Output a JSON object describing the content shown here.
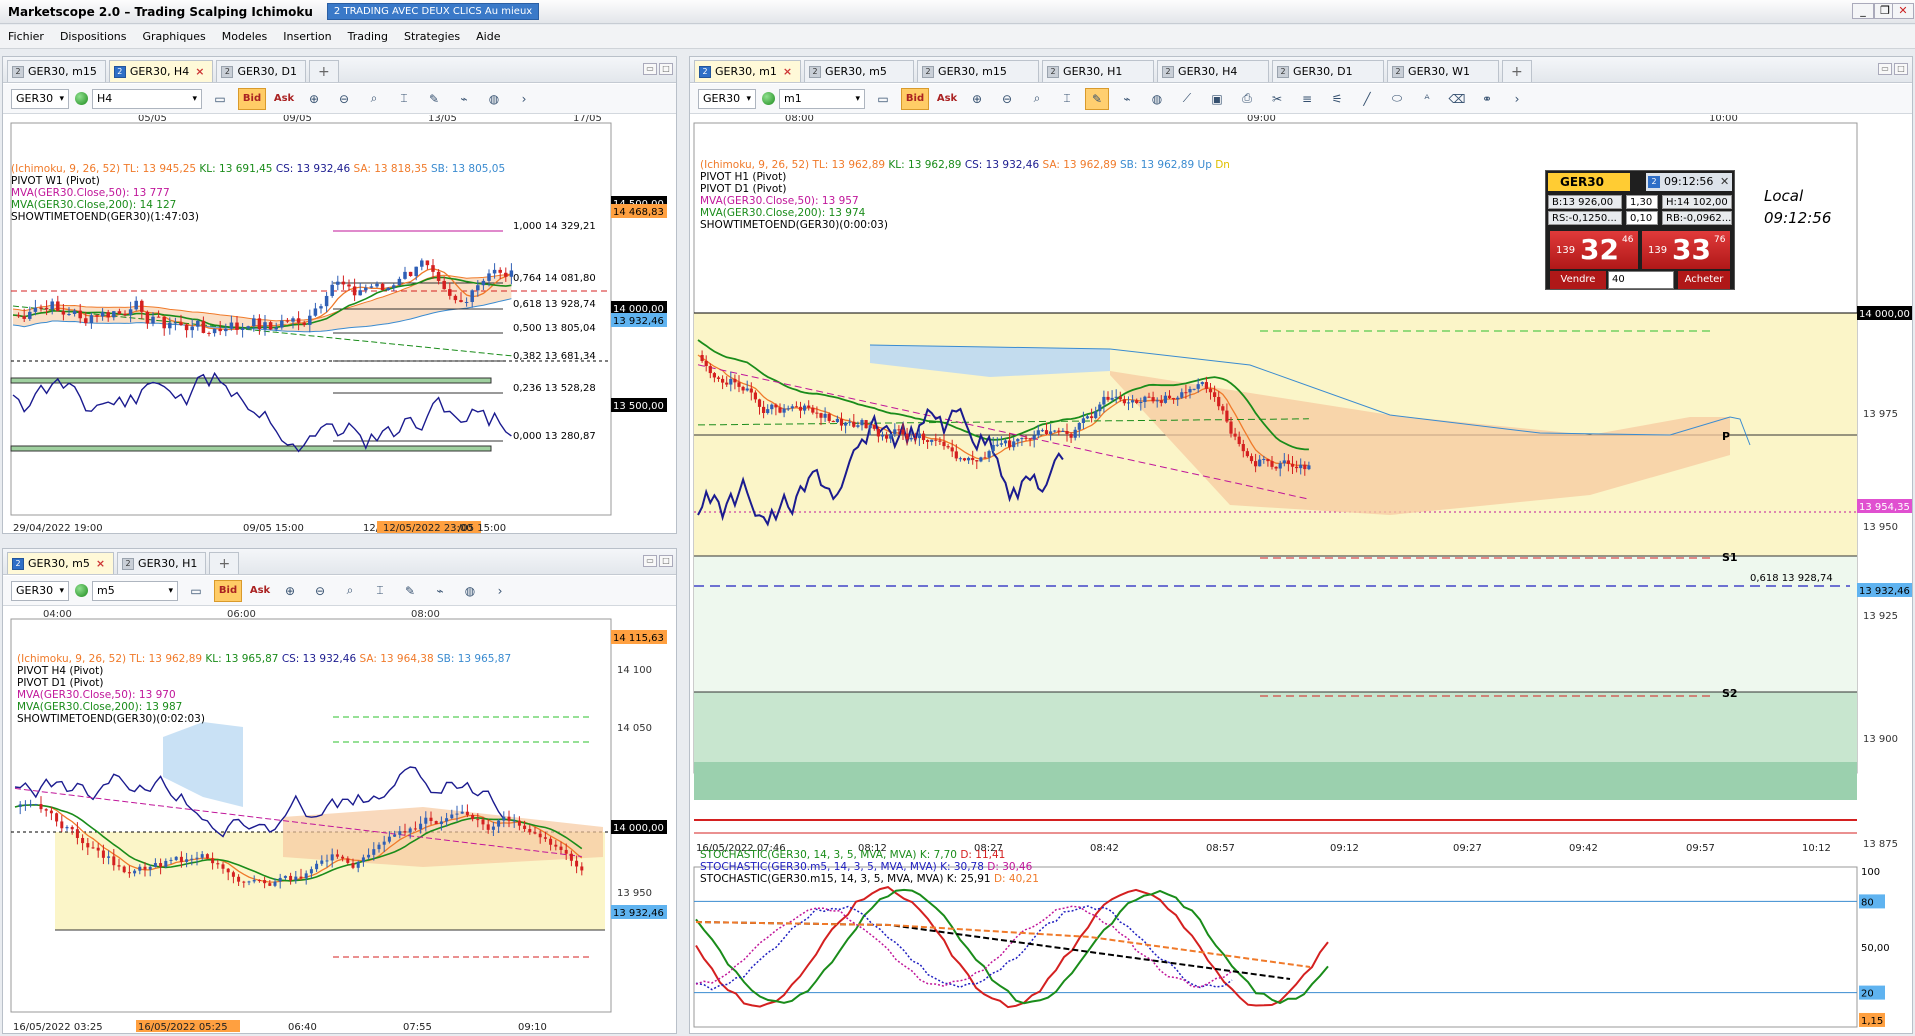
{
  "app": {
    "title": "Marketscope 2.0 – Trading Scalping Ichimoku",
    "badge": "TRADING AVEC DEUX CLICS Au mieux",
    "badge_num": "2",
    "win_min": "_",
    "win_max": "❐",
    "win_close": "✕"
  },
  "menu": [
    "Fichier",
    "Dispositions",
    "Graphiques",
    "Modeles",
    "Insertion",
    "Trading",
    "Strategies",
    "Aide"
  ],
  "panel_tl": {
    "tabs": [
      {
        "label": "GER30, m15",
        "icon": "2"
      },
      {
        "label": "GER30, H4",
        "icon": "2",
        "active": true
      },
      {
        "label": "GER30, D1",
        "icon": "2"
      }
    ],
    "symbol": "GER30",
    "timeframe": "H4",
    "bid": "Bid",
    "ask": "Ask",
    "dates": [
      "05/05",
      "09/05",
      "13/05",
      "17/05"
    ],
    "legend": {
      "ichimoku": "(Ichimoku, 9, 26, 52)",
      "tl": "TL: 13 945,25",
      "kl": "KL: 13 691,45",
      "cs": "CS: 13 932,46",
      "sa": "SA: 13 818,35",
      "sb": "SB: 13 805,05",
      "pivot": "PIVOT W1 (Pivot)",
      "mva50": "MVA(GER30.Close,50): 13 777",
      "mva200": "MVA(GER30.Close,200): 14 127",
      "showtime": "SHOWTIMETOEND(GER30)(1:47:03)"
    },
    "fibs": [
      "1,000 14 329,21",
      "0,764 14 081,80",
      "0,618 13 928,74",
      "0,500 13 805,04",
      "0,382 13 681,34",
      "0,236 13 528,28",
      "0,000 13 280,87"
    ],
    "price_tags": [
      "14 500,00",
      "14 468,83",
      "14 000,00",
      "13 932,46",
      "13 500,00"
    ],
    "bottom_axis": [
      "29/04/2022 19:00",
      "09/05 15:00",
      "12/",
      "12/05/2022 23:00",
      "/05 15:00"
    ]
  },
  "panel_bl": {
    "tabs": [
      {
        "label": "GER30, m5",
        "icon": "2",
        "active": true
      },
      {
        "label": "GER30, H1",
        "icon": "2"
      }
    ],
    "symbol": "GER30",
    "timeframe": "m5",
    "bid": "Bid",
    "ask": "Ask",
    "times": [
      "04:00",
      "06:00",
      "08:00"
    ],
    "legend": {
      "ichimoku": "(Ichimoku, 9, 26, 52)",
      "tl": "TL: 13 962,89",
      "kl": "KL: 13 965,87",
      "cs": "CS: 13 932,46",
      "sa": "SA: 13 964,38",
      "sb": "SB: 13 965,87",
      "pivot1": "PIVOT H4 (Pivot)",
      "pivot2": "PIVOT D1 (Pivot)",
      "mva50": "MVA(GER30.Close,50): 13 970",
      "mva200": "MVA(GER30.Close,200): 13 987",
      "showtime": "SHOWTIMETOEND(GER30)(0:02:03)"
    },
    "price_labels": [
      "14 115,63",
      "14 100",
      "14 050",
      "14 000,00",
      "13 950",
      "13 932,46"
    ],
    "bottom_axis": [
      "16/05/2022 03:25",
      "16/05/2022 05:25",
      "06:40",
      "07:55",
      "09:10"
    ]
  },
  "panel_main": {
    "tabs": [
      {
        "label": "GER30, m1",
        "icon": "2",
        "active": true
      },
      {
        "label": "GER30, m5",
        "icon": "2"
      },
      {
        "label": "GER30, m15",
        "icon": "2"
      },
      {
        "label": "GER30, H1",
        "icon": "2"
      },
      {
        "label": "GER30, H4",
        "icon": "2"
      },
      {
        "label": "GER30, D1",
        "icon": "2"
      },
      {
        "label": "GER30, W1",
        "icon": "2"
      }
    ],
    "symbol": "GER30",
    "timeframe": "m1",
    "bid": "Bid",
    "ask": "Ask",
    "times": [
      "08:00",
      "09:00",
      "10:00"
    ],
    "legend": {
      "ichimoku": "(Ichimoku, 9, 26, 52)",
      "tl": "TL: 13 962,89",
      "kl": "KL: 13 962,89",
      "cs": "CS: 13 932,46",
      "sa": "SA: 13 962,89",
      "sb": "SB: 13 962,89",
      "up": "Up",
      "dn": "Dn",
      "pivot1": "PIVOT H1 (Pivot)",
      "pivot2": "PIVOT D1 (Pivot)",
      "mva50": "MVA(GER30.Close,50): 13 957",
      "mva200": "MVA(GER30.Close,200): 13 974",
      "showtime": "SHOWTIMETOEND(GER30)(0:00:03)"
    },
    "local_label": "Local",
    "local_time": "09:12:56",
    "pivot_labels": [
      "P",
      "S1",
      "S2"
    ],
    "fib_label": "0,618 13 928,74",
    "price_labels": [
      "14 000,00",
      "13 975",
      "13 954,35",
      "13 950",
      "13 932,46",
      "13 925",
      "13 900",
      "13 875"
    ],
    "bottom_axis": [
      "16/05/2022 07:46",
      "08:12",
      "08:27",
      "08:42",
      "08:57",
      "09:12",
      "09:27",
      "09:42",
      "09:57",
      "10:12"
    ],
    "stoch": {
      "l1": "STOCHASTIC(GER30, 14, 3, 5, MVA, MVA)",
      "l1k": "K: 7,70",
      "l1d": "D: 11,41",
      "l2": "STOCHASTIC(GER30.m5, 14, 3, 5, MVA, MVA)",
      "l2k": "K: 30,78",
      "l2d": "D: 30,46",
      "l3": "STOCHASTIC(GER30.m15, 14, 3, 5, MVA, MVA)",
      "l3k": "K: 25,91",
      "l3d": "D: 40,21",
      "levels": [
        "100",
        "80",
        "50,00",
        "20",
        "1,15"
      ]
    }
  },
  "trade_box": {
    "symbol": "GER30",
    "time": "09:12:56",
    "tab_num": "2",
    "b": "B:13 926,00",
    "spread": "1,30",
    "h": "H:14 102,00",
    "rs": "RS:-0,1250...",
    "lot": "0,10",
    "rb": "RB:-0,0962...",
    "sell_prefix": "139",
    "sell_big": "32",
    "sell_sup": "46",
    "buy_prefix": "139",
    "buy_big": "33",
    "buy_sup": "76",
    "sell_label": "Vendre",
    "qty": "40",
    "buy_label": "Acheter"
  },
  "colors": {
    "tenkan": "#f07a2a",
    "kijun": "#1a8c1a",
    "chikou": "#1b1b8f",
    "cloud_up": "#bcd9f2",
    "cloud_dn": "#f7c9a0",
    "bull": "#2f5fb5",
    "bear": "#d42020",
    "stoch_k": "#d42020",
    "stoch_d": "#1a8c1a"
  }
}
